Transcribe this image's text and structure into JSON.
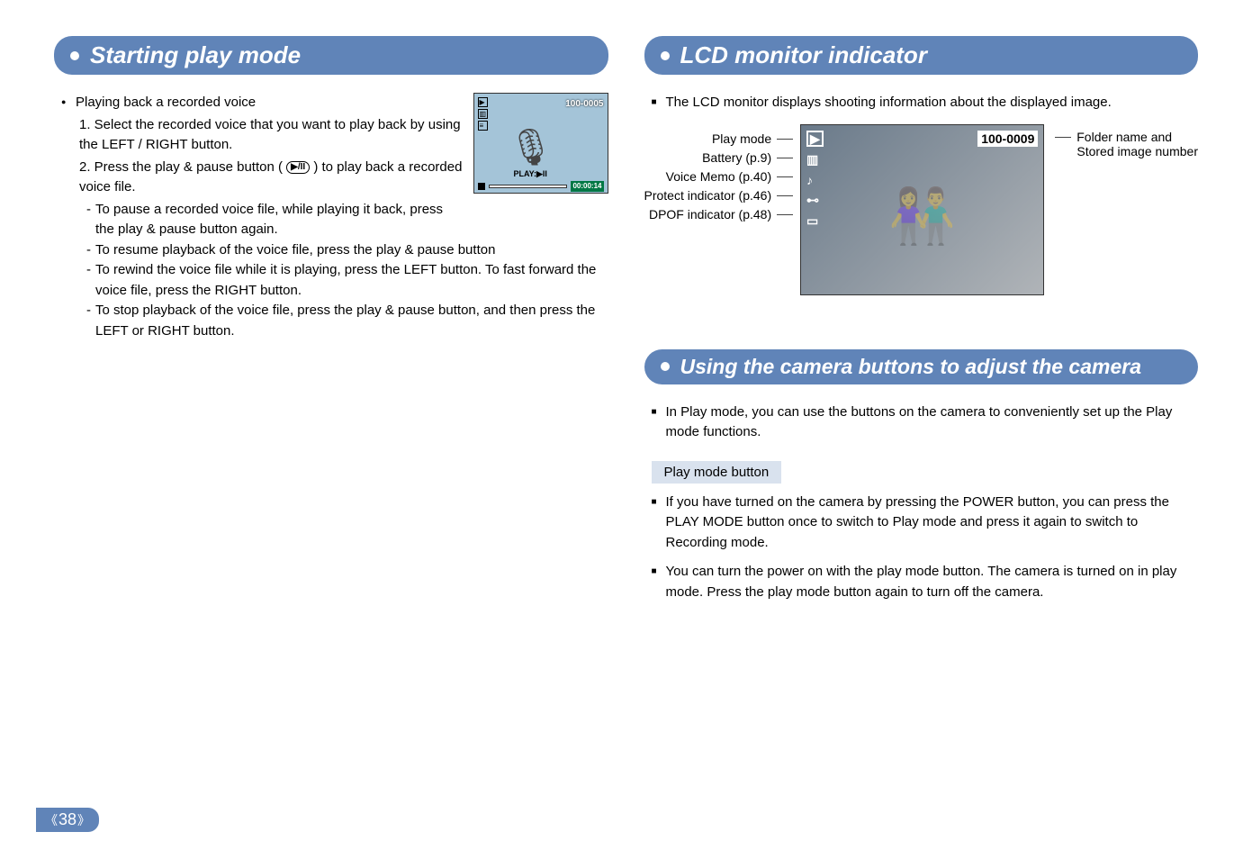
{
  "page_number": "38",
  "left": {
    "title": "Starting play mode",
    "bullet": "Playing back a recorded voice",
    "steps": [
      "1. Select the recorded voice that you want to play back by using the LEFT / RIGHT button.",
      "2. Press the play & pause button ( "
    ],
    "step2_tail": " ) to play back a recorded voice file.",
    "play_pause_icon_text": "▶/II",
    "subs": [
      "To pause a recorded voice file, while playing it back, press the play & pause button again.",
      "To resume playback of the voice file, press the play & pause button",
      "To rewind the voice file while it is playing, press the LEFT button. To fast forward the voice file, press the RIGHT button.",
      "To stop playback of the voice file, press the play & pause button, and then press the LEFT or RIGHT button."
    ],
    "screenshot": {
      "folder": "100-0005",
      "play_label": "PLAY:▶II",
      "time": "00:00:14"
    }
  },
  "right1": {
    "title": "LCD monitor indicator",
    "intro": "The LCD monitor displays shooting information about the displayed image.",
    "labels": [
      "Play mode",
      "Battery (p.9)",
      "Voice Memo (p.40)",
      "Protect indicator (p.46)",
      "DPOF indicator (p.48)"
    ],
    "folder": "100-0009",
    "right_label1": "Folder name and",
    "right_label2": "Stored image number"
  },
  "right2": {
    "title": "Using the camera buttons to adjust the camera",
    "intro": "In Play mode, you can use the buttons on the camera to conveniently set up the Play mode functions.",
    "subhead": "Play mode button",
    "paras": [
      "If you have turned on the camera by pressing the POWER button, you can press the PLAY MODE button once to switch to Play mode and press it again to switch to Recording mode.",
      "You can turn the power on with the play mode button. The camera is turned on in play mode. Press the play mode button again to turn off the camera."
    ]
  }
}
